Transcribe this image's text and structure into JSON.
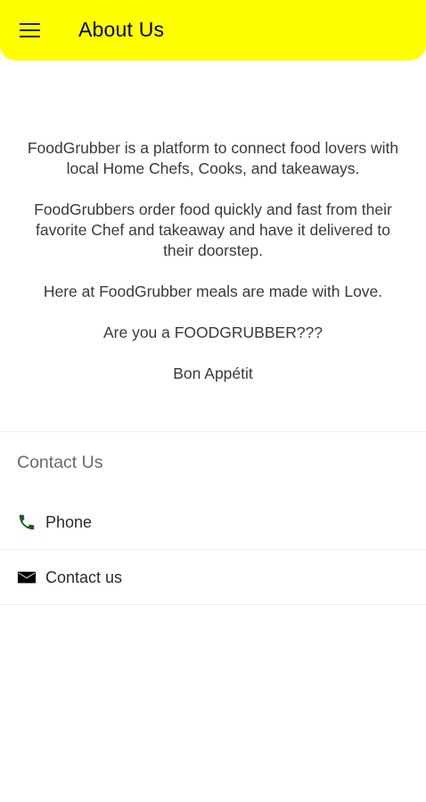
{
  "header": {
    "title": "About Us",
    "menu_icon": "hamburger-menu-icon",
    "background": "#ffff00"
  },
  "about": {
    "paragraphs": [
      "FoodGrubber is a platform to connect food lovers with local Home Chefs, Cooks, and takeaways.",
      "FoodGrubbers order food quickly and fast from their favorite Chef and takeaway and have it delivered to their doorstep.",
      "Here at FoodGrubber meals are made with Love.",
      "Are you a FOODGRUBBER???",
      "Bon Appétit"
    ]
  },
  "contact": {
    "header": "Contact Us",
    "items": [
      {
        "label": "Phone",
        "icon": "phone-icon",
        "icon_color": "#1b5e20"
      },
      {
        "label": "Contact us",
        "icon": "email-icon",
        "icon_color": "#000000"
      }
    ]
  }
}
